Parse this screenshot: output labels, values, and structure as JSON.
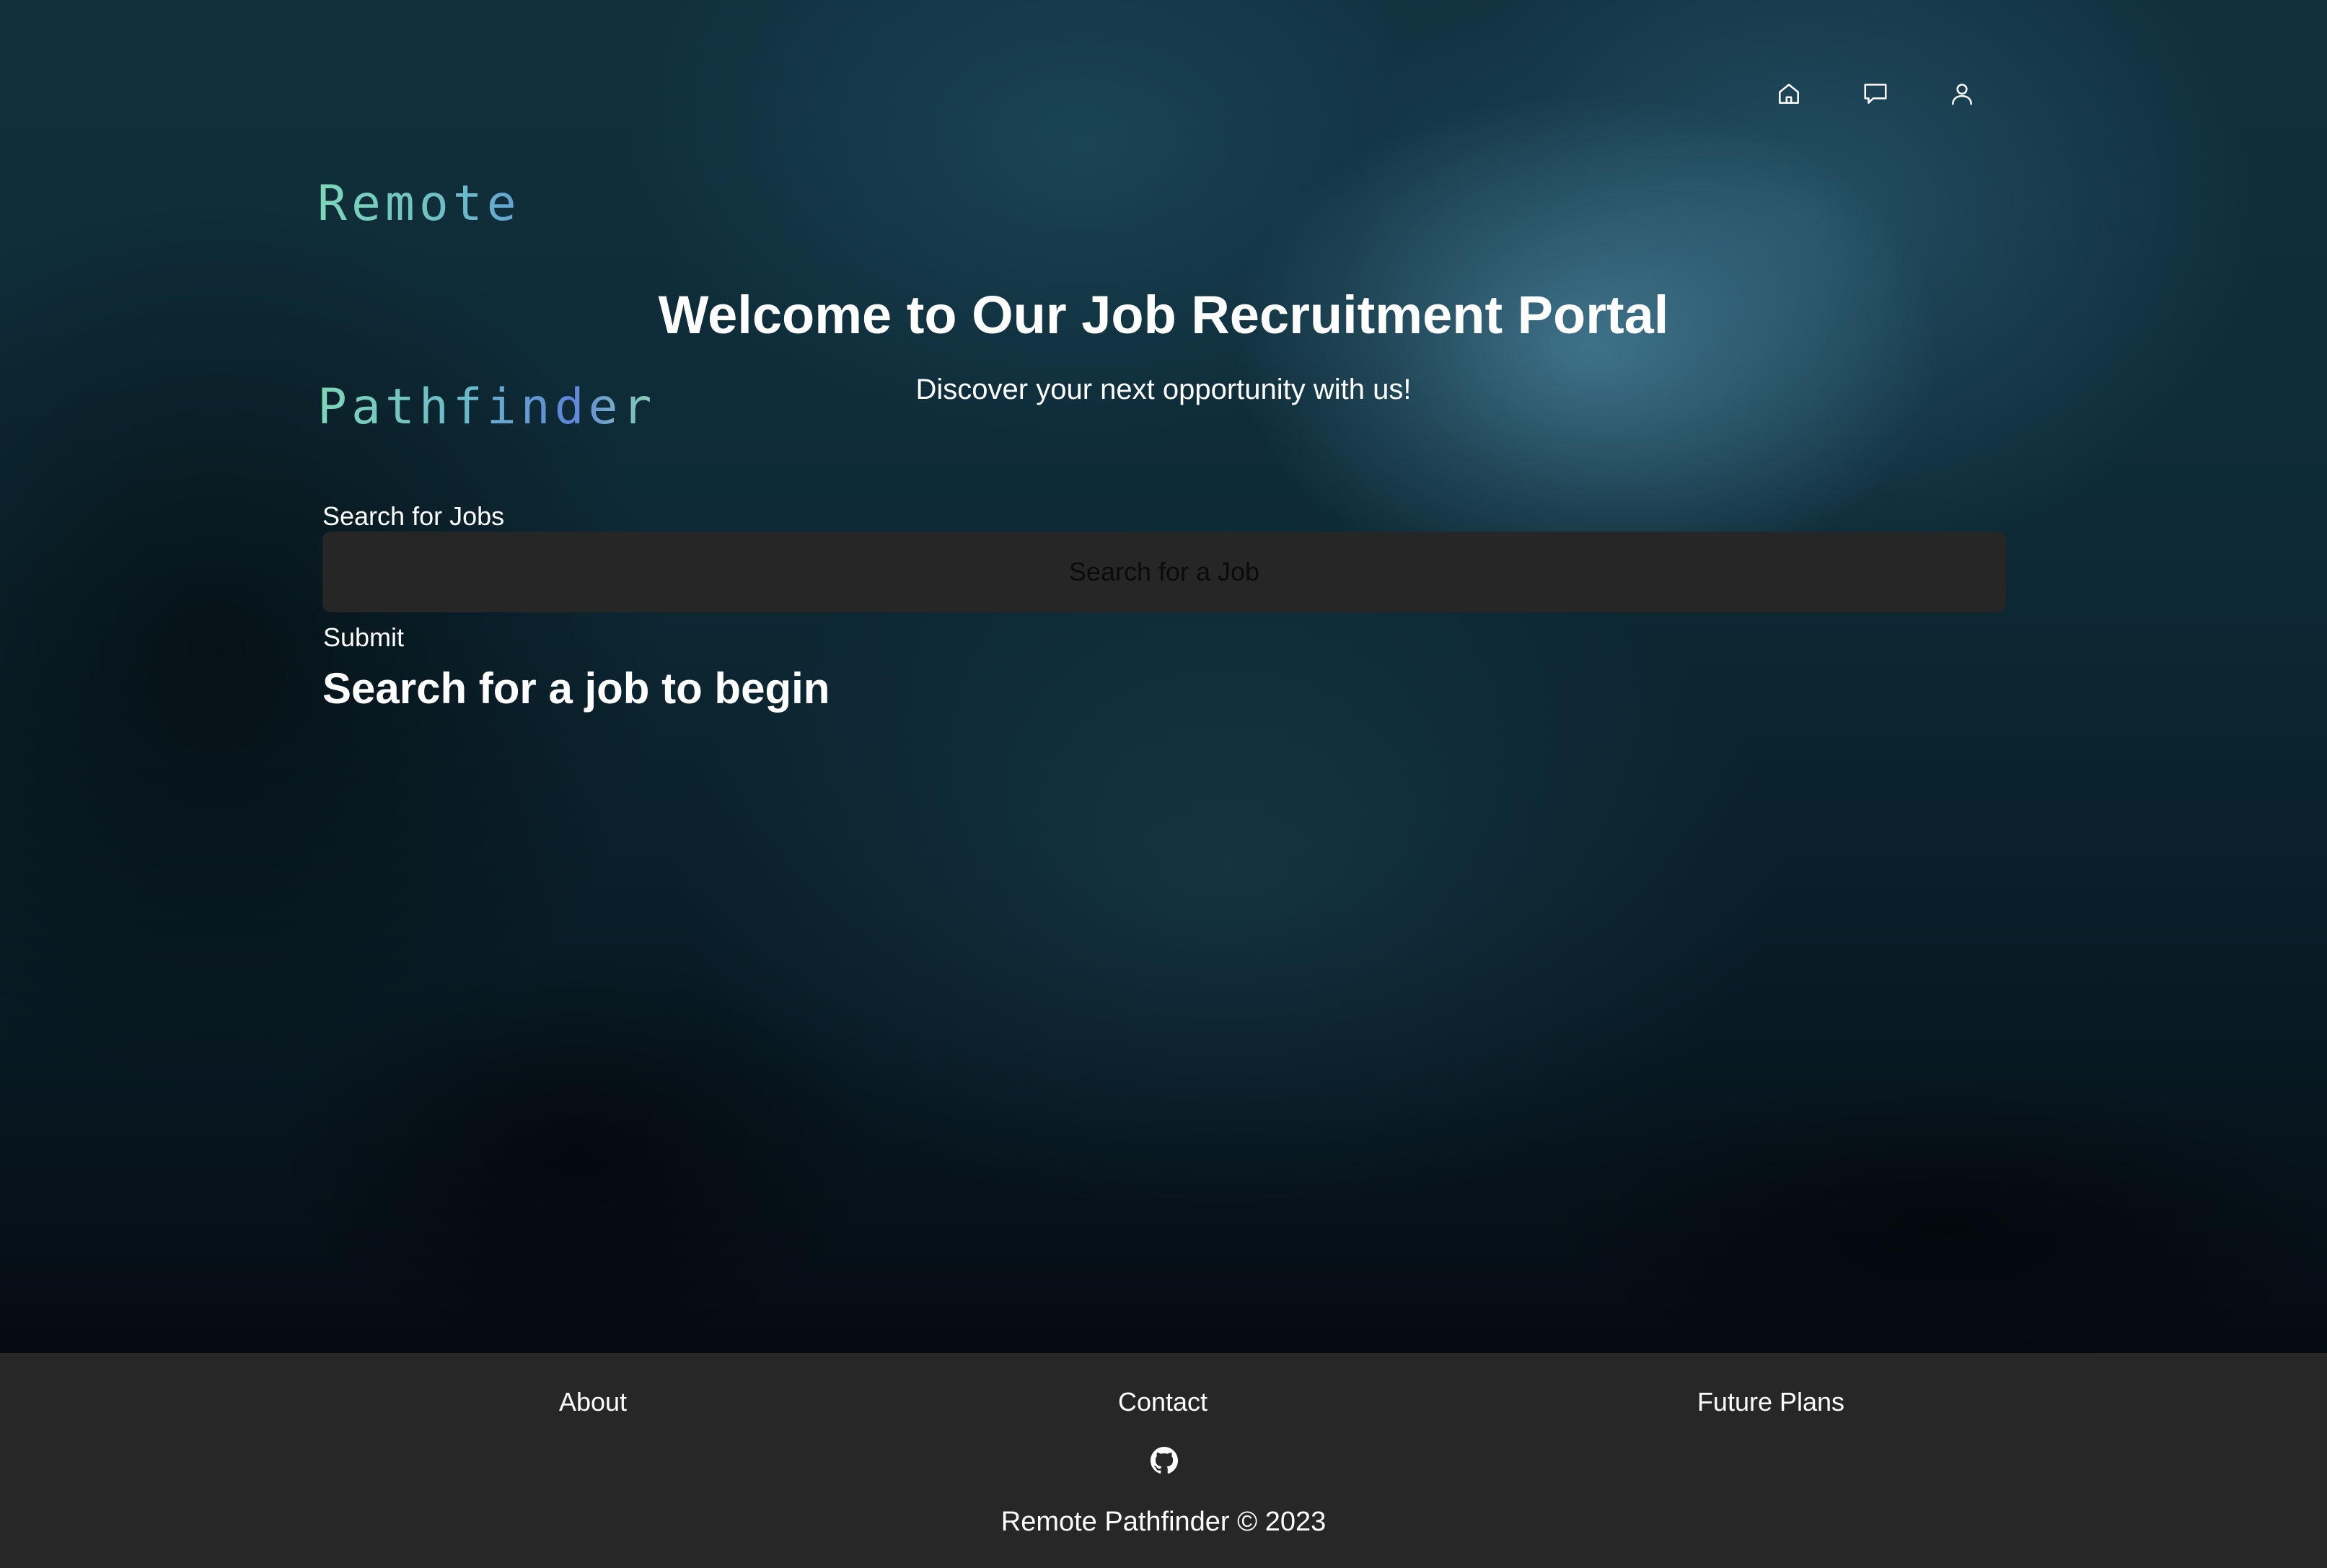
{
  "logo": {
    "line1": "Remote",
    "line2": "Pathfinder"
  },
  "nav": [
    {
      "icon": "home-icon",
      "label": "Home"
    },
    {
      "icon": "chat-icon",
      "label": "Messages"
    },
    {
      "icon": "user-icon",
      "label": "Profile"
    }
  ],
  "hero": {
    "title": "Welcome to Our Job Recruitment Portal",
    "subtitle": "Discover your next opportunity with us!"
  },
  "search": {
    "label": "Search for Jobs",
    "placeholder": "Search for a Job",
    "value": "",
    "submit_label": "Submit",
    "empty_message": "Search for a job to begin"
  },
  "footer": {
    "links": [
      "About",
      "Contact",
      "Future Plans"
    ],
    "copyright": "Remote Pathfinder © 2023"
  },
  "colors": {
    "footer_bg": "#272727",
    "input_bg": "#262626",
    "text": "#ffffff"
  }
}
